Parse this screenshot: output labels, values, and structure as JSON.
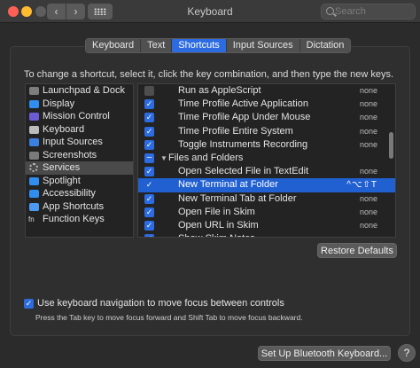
{
  "window": {
    "title": "Keyboard"
  },
  "search": {
    "placeholder": "Search"
  },
  "tabs": [
    {
      "label": "Keyboard",
      "active": false
    },
    {
      "label": "Text",
      "active": false
    },
    {
      "label": "Shortcuts",
      "active": true
    },
    {
      "label": "Input Sources",
      "active": false
    },
    {
      "label": "Dictation",
      "active": false
    }
  ],
  "instructions": "To change a shortcut, select it, click the key combination, and then type the new keys.",
  "categories": [
    {
      "label": "Launchpad & Dock",
      "icon": "launchpad-icon",
      "color": "#7d7d7d",
      "selected": false
    },
    {
      "label": "Display",
      "icon": "display-icon",
      "color": "#2f8ef0",
      "selected": false
    },
    {
      "label": "Mission Control",
      "icon": "mission-control-icon",
      "color": "#6d5bd6",
      "selected": false
    },
    {
      "label": "Keyboard",
      "icon": "keyboard-icon",
      "color": "#bdbdbd",
      "selected": false
    },
    {
      "label": "Input Sources",
      "icon": "input-sources-icon",
      "color": "#3b7fe0",
      "selected": false
    },
    {
      "label": "Screenshots",
      "icon": "screenshots-icon",
      "color": "#7a7a7a",
      "selected": false
    },
    {
      "label": "Services",
      "icon": "gear-icon",
      "color": "#bbbbbb",
      "selected": true
    },
    {
      "label": "Spotlight",
      "icon": "spotlight-icon",
      "color": "#2f8ef0",
      "selected": false
    },
    {
      "label": "Accessibility",
      "icon": "accessibility-icon",
      "color": "#2f8ef0",
      "selected": false
    },
    {
      "label": "App Shortcuts",
      "icon": "app-shortcuts-icon",
      "color": "#4d9af5",
      "selected": false
    },
    {
      "label": "Function Keys",
      "icon": "fn-icon",
      "color": "#dddddd",
      "selected": false
    }
  ],
  "shortcuts": [
    {
      "label": "Run as AppleScript",
      "key": "none",
      "state": "off",
      "group": false,
      "selected": false
    },
    {
      "label": "Time Profile Active Application",
      "key": "none",
      "state": "on",
      "group": false,
      "selected": false
    },
    {
      "label": "Time Profile App Under Mouse",
      "key": "none",
      "state": "on",
      "group": false,
      "selected": false
    },
    {
      "label": "Time Profile Entire System",
      "key": "none",
      "state": "on",
      "group": false,
      "selected": false
    },
    {
      "label": "Toggle Instruments Recording",
      "key": "none",
      "state": "on",
      "group": false,
      "selected": false
    },
    {
      "label": "Files and Folders",
      "key": "",
      "state": "mixed",
      "group": true,
      "selected": false
    },
    {
      "label": "Open Selected File in TextEdit",
      "key": "none",
      "state": "on",
      "group": false,
      "selected": false
    },
    {
      "label": "New Terminal at Folder",
      "key": "^⌥⇧T",
      "state": "on",
      "group": false,
      "selected": true
    },
    {
      "label": "New Terminal Tab at Folder",
      "key": "none",
      "state": "on",
      "group": false,
      "selected": false
    },
    {
      "label": "Open File in Skim",
      "key": "none",
      "state": "on",
      "group": false,
      "selected": false
    },
    {
      "label": "Open URL in Skim",
      "key": "none",
      "state": "on",
      "group": false,
      "selected": false
    },
    {
      "label": "Show Skim Notes",
      "key": "",
      "state": "on",
      "group": false,
      "selected": false
    }
  ],
  "restore_defaults": "Restore Defaults",
  "keyboard_nav": {
    "checked": true,
    "label": "Use keyboard navigation to move focus between controls",
    "hint": "Press the Tab key to move focus forward and Shift Tab to move focus backward."
  },
  "bluetooth_button": "Set Up Bluetooth Keyboard...",
  "help": "?"
}
